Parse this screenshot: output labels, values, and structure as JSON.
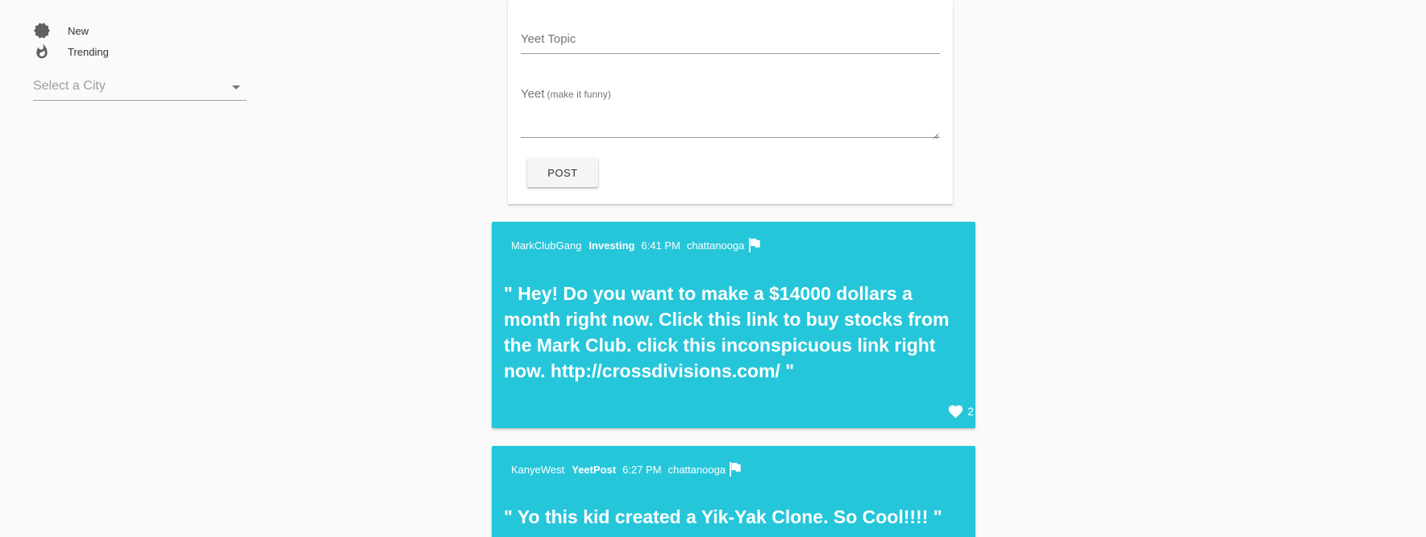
{
  "nav": {
    "items": [
      {
        "label": "New",
        "icon": "new-badge-icon"
      },
      {
        "label": "Trending",
        "icon": "fire-icon"
      }
    ],
    "city_select": {
      "placeholder": "Select a City"
    }
  },
  "compose": {
    "topic_placeholder": "Yeet Topic",
    "yeet_placeholder": "Yeet",
    "yeet_hint": "(make it funny)",
    "post_label": "POST"
  },
  "posts": [
    {
      "author": "MarkClubGang",
      "topic": "Investing",
      "time": "6:41 PM",
      "city": "chattanooga",
      "text": "\" Hey! Do you want to make a $14000 dollars a month right now. Click this link to buy stocks from the Mark Club. click this inconspicuous link right now. http://crossdivisions.com/ \"",
      "likes": "2"
    },
    {
      "author": "KanyeWest",
      "topic": "YeetPost",
      "time": "6:27 PM",
      "city": "chattanooga",
      "text": "\" Yo this kid created a Yik-Yak Clone. So Cool!!!! \""
    }
  ],
  "colors": {
    "card": "#26c6da",
    "background": "#fafafa"
  }
}
